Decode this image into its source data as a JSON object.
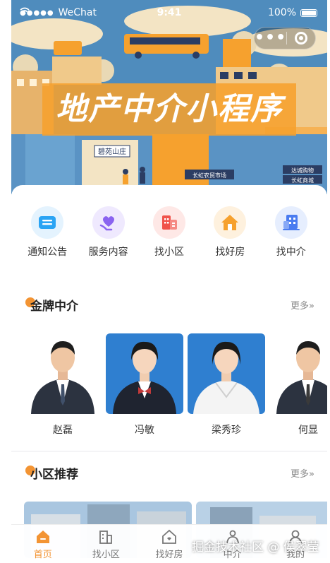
{
  "status_bar": {
    "carrier_dots": "●●●●●",
    "carrier": "WeChat",
    "time": "9:41",
    "battery": "100%"
  },
  "capsule": {
    "more": "•••"
  },
  "banner": {
    "title": "地产中介小程序",
    "signs": [
      "碧苑山庄",
      "长虹农贸市场",
      "达城购物",
      "长虹商城"
    ]
  },
  "nav": [
    {
      "label": "通知公告",
      "icon": "notice-icon",
      "color": "#2aa4f4"
    },
    {
      "label": "服务内容",
      "icon": "heart-hand-icon",
      "color": "#8a63f0"
    },
    {
      "label": "找小区",
      "icon": "building-icon",
      "color": "#f0524a"
    },
    {
      "label": "找好房",
      "icon": "house-icon",
      "color": "#f6a12e"
    },
    {
      "label": "找中介",
      "icon": "office-icon",
      "color": "#4a7cf0"
    }
  ],
  "agents_section": {
    "title": "金牌中介",
    "more": "更多»"
  },
  "agents": [
    {
      "name": "赵磊",
      "bg": "#ffffff"
    },
    {
      "name": "冯敏",
      "bg": "#2f7fd0"
    },
    {
      "name": "梁秀珍",
      "bg": "#2f7fd0"
    },
    {
      "name": "何显",
      "bg": "#ffffff"
    }
  ],
  "estates_section": {
    "title": "小区推荐",
    "more": "更多»"
  },
  "tabs": [
    {
      "label": "首页",
      "icon": "home-icon",
      "active": true
    },
    {
      "label": "找小区",
      "icon": "estate-icon",
      "active": false
    },
    {
      "label": "找好房",
      "icon": "house-outline-icon",
      "active": false
    },
    {
      "label": "中介",
      "icon": "agent-icon",
      "active": false
    },
    {
      "label": "我的",
      "icon": "user-icon",
      "active": false
    }
  ],
  "watermark": "掘金技术社区 @ 侯翠莹",
  "colors": {
    "accent": "#f39433",
    "banner_sky": "#4a86b8",
    "banner_orange": "#f6a12e"
  }
}
